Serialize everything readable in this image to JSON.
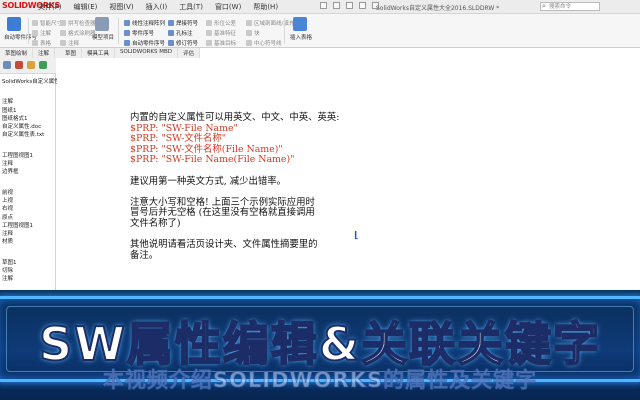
{
  "app": {
    "logo": "SOLIDWORKS",
    "window_title": "SolidWorks自定义属性大全2016.SLDDRW *",
    "search_placeholder": "搜索命令"
  },
  "menu": [
    "文件(F)",
    "编辑(E)",
    "视图(V)",
    "插入(I)",
    "工具(T)",
    "窗口(W)",
    "帮助(H)"
  ],
  "ribbon": {
    "left_buttons": [
      "自动零件序号",
      "模型项目"
    ],
    "cmds_col1": [
      "智能尺寸",
      "注解",
      "表格"
    ],
    "cmds_col2": [
      "拼写检查器",
      "格式涂刷器",
      "注释"
    ],
    "cmds_col3": [
      "线性注释阵列",
      "零件序号",
      "自动零件序号"
    ],
    "cmds_col4": [
      "焊接符号",
      "孔标注",
      "修订符号"
    ],
    "cmds_col5": [
      "形位公差",
      "基准特征",
      "基准目标"
    ],
    "cmds_col6": [
      "区域剖面线/填充",
      "块",
      "中心符号线"
    ],
    "right_btn": "插入表格"
  },
  "tabs": [
    "草图绘制",
    "注解",
    "评估",
    "草图",
    "模具工具",
    "SOLIDWORKS MBD",
    "评估"
  ],
  "feature_tree": [
    "SolidWorks自定义属性大全2016 (图纸1)",
    "",
    "注解",
    "图纸1",
    "图纸格式1",
    "自定义属性.doc",
    "自定义属性表.txt",
    "",
    "工程图视图1",
    "注释",
    "边界框",
    "",
    "前视",
    "上视",
    "右视",
    "原点",
    "工程图视图1",
    "注释",
    "材质",
    "",
    "草图1",
    "切除",
    "注解"
  ],
  "note": {
    "line1": "内置的自定义属性可以用英文、中文、中英、英英:",
    "prp1": "$PRP: \"SW-File Name\"",
    "prp2": "$PRP: \"SW-文件名称\"",
    "prp3": "$PRP: \"SW-文件名称(File Name)\"",
    "prp4": "$PRP: \"SW-File Name(File Name)\"",
    "line2": "建议用第一种英文方式, 减少出错率。",
    "line3": "注意大小写和空格! 上面三个示例实际应用时",
    "line4": "冒号后并无空格 (在这里没有空格就直接调用",
    "line5": "文件名称了)",
    "line6": "其他说明请看活页设计夹、文件属性摘要里的",
    "line7": "备注。"
  },
  "banner": {
    "title": "SW属性编辑&关联关键字",
    "subtitle": "本视频介绍SOLIDWORKS的属性及关键字"
  },
  "colors": {
    "accent_red": "#d03a22",
    "banner_blue": "#0e3a78",
    "frame_blue": "#4fb6ff"
  }
}
